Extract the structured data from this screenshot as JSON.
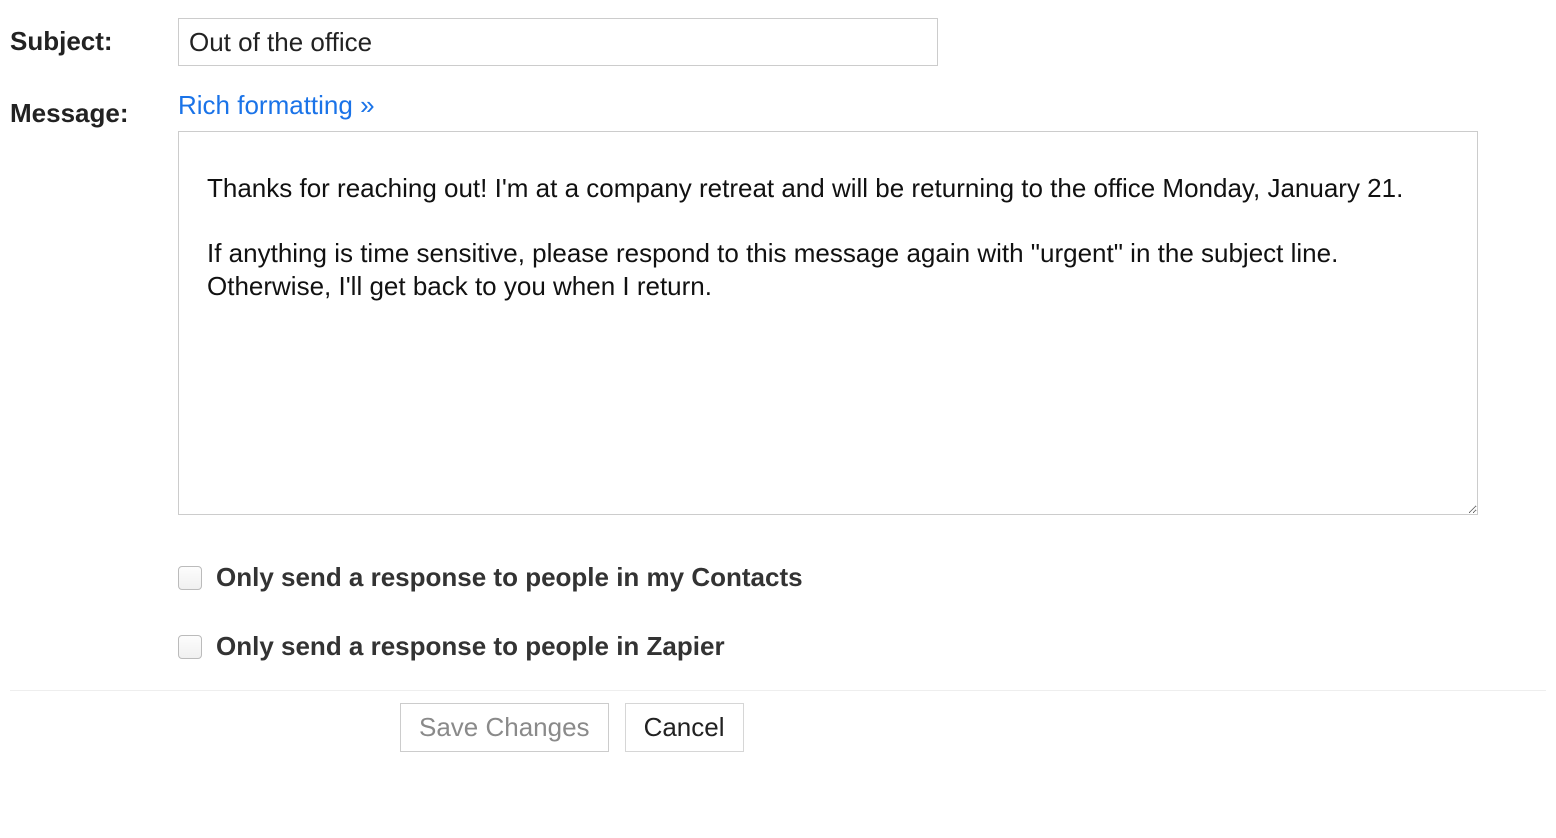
{
  "subject": {
    "label": "Subject:",
    "value": "Out of the office"
  },
  "message": {
    "label": "Message:",
    "rich_link": "Rich formatting »",
    "body": "Thanks for reaching out! I'm at a company retreat and will be returning to the office Monday, January 21.\n\nIf anything is time sensitive, please respond to this message again with \"urgent\" in the subject line. Otherwise, I'll get back to you when I return."
  },
  "options": {
    "contacts_only": "Only send a response to people in my Contacts",
    "domain_only": "Only send a response to people in Zapier"
  },
  "buttons": {
    "save": "Save Changes",
    "cancel": "Cancel"
  }
}
